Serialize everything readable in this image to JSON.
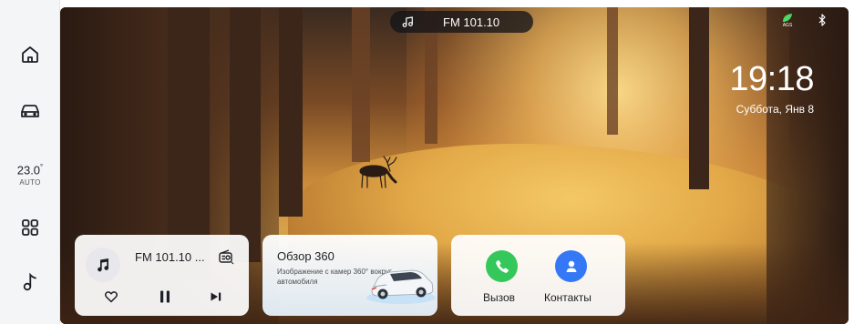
{
  "top_bar": {
    "radio_station": "FM 101.10"
  },
  "clock": {
    "time": "19:18",
    "date": "Суббота,  Янв 8"
  },
  "climate": {
    "temperature": "23.0",
    "unit": "°",
    "mode": "AUTO"
  },
  "rail": {
    "icons": [
      "home-icon",
      "car-icon",
      "apps-grid-icon",
      "music-icon"
    ]
  },
  "status": {
    "eco_badge": "AGS",
    "bluetooth": "bluetooth-icon"
  },
  "cards": {
    "radio": {
      "title": "FM 101.10 ...",
      "icons": [
        "music-note-icon",
        "radio-source-icon",
        "heart-icon",
        "pause-icon",
        "next-icon"
      ]
    },
    "view360": {
      "title": "Обзор 360",
      "description": "Изображение с камер 360° вокруг автомобиля"
    },
    "phone": {
      "call_label": "Вызов",
      "contacts_label": "Контакты"
    }
  },
  "colors": {
    "call_green": "#34c759",
    "contacts_blue": "#3478f6",
    "rail_bg": "#f4f5f7"
  }
}
